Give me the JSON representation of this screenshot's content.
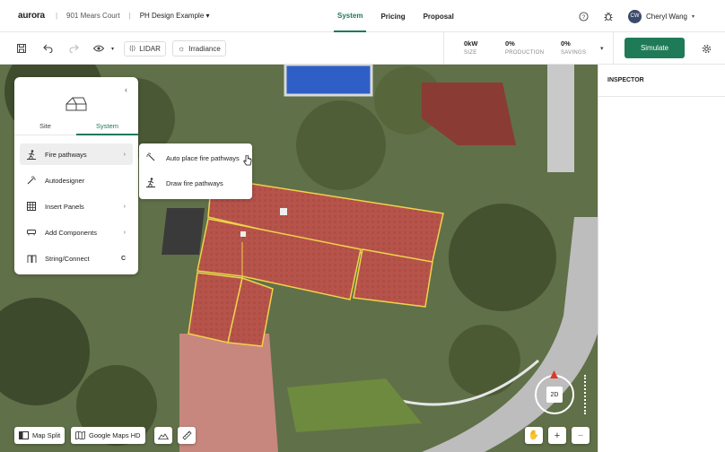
{
  "app": {
    "logo": "aurora"
  },
  "breadcrumb": {
    "project": "901 Mears Court",
    "design": "PH Design Example"
  },
  "nav": {
    "tabs": [
      "System",
      "Pricing",
      "Proposal"
    ],
    "active": "System"
  },
  "user": {
    "initials": "CW",
    "name": "Cheryl Wang"
  },
  "toolbar": {
    "lidar": "LIDAR",
    "irradiance": "Irradiance"
  },
  "metrics": [
    {
      "value": "0kW",
      "label": "SIZE"
    },
    {
      "value": "0%",
      "label": "PRODUCTION"
    },
    {
      "value": "0%",
      "label": "SAVINGS"
    }
  ],
  "simulate_label": "Simulate",
  "inspector": {
    "title": "INSPECTOR"
  },
  "panel": {
    "tabs": [
      "Site",
      "System"
    ],
    "active_tab": "System",
    "items": [
      {
        "label": "Fire pathways",
        "icon": "person-walk-icon",
        "submenu": true
      },
      {
        "label": "Autodesigner",
        "icon": "wand-icon",
        "submenu": false
      },
      {
        "label": "Insert Panels",
        "icon": "grid-icon",
        "submenu": true
      },
      {
        "label": "Add Components",
        "icon": "component-icon",
        "submenu": true
      },
      {
        "label": "String/Connect",
        "icon": "string-icon",
        "shortcut": "C"
      }
    ]
  },
  "submenu": {
    "items": [
      {
        "label": "Auto place fire pathways",
        "icon": "wand-icon"
      },
      {
        "label": "Draw fire pathways",
        "icon": "person-walk-icon"
      }
    ]
  },
  "bottom_bar": {
    "map_split": "Map Split",
    "map_source": "Google Maps HD"
  },
  "view_control": {
    "mode": "2D"
  },
  "colors": {
    "accent": "#1f7a58",
    "roof_fill": "#b6544c",
    "roof_edge": "#f0d24a"
  }
}
